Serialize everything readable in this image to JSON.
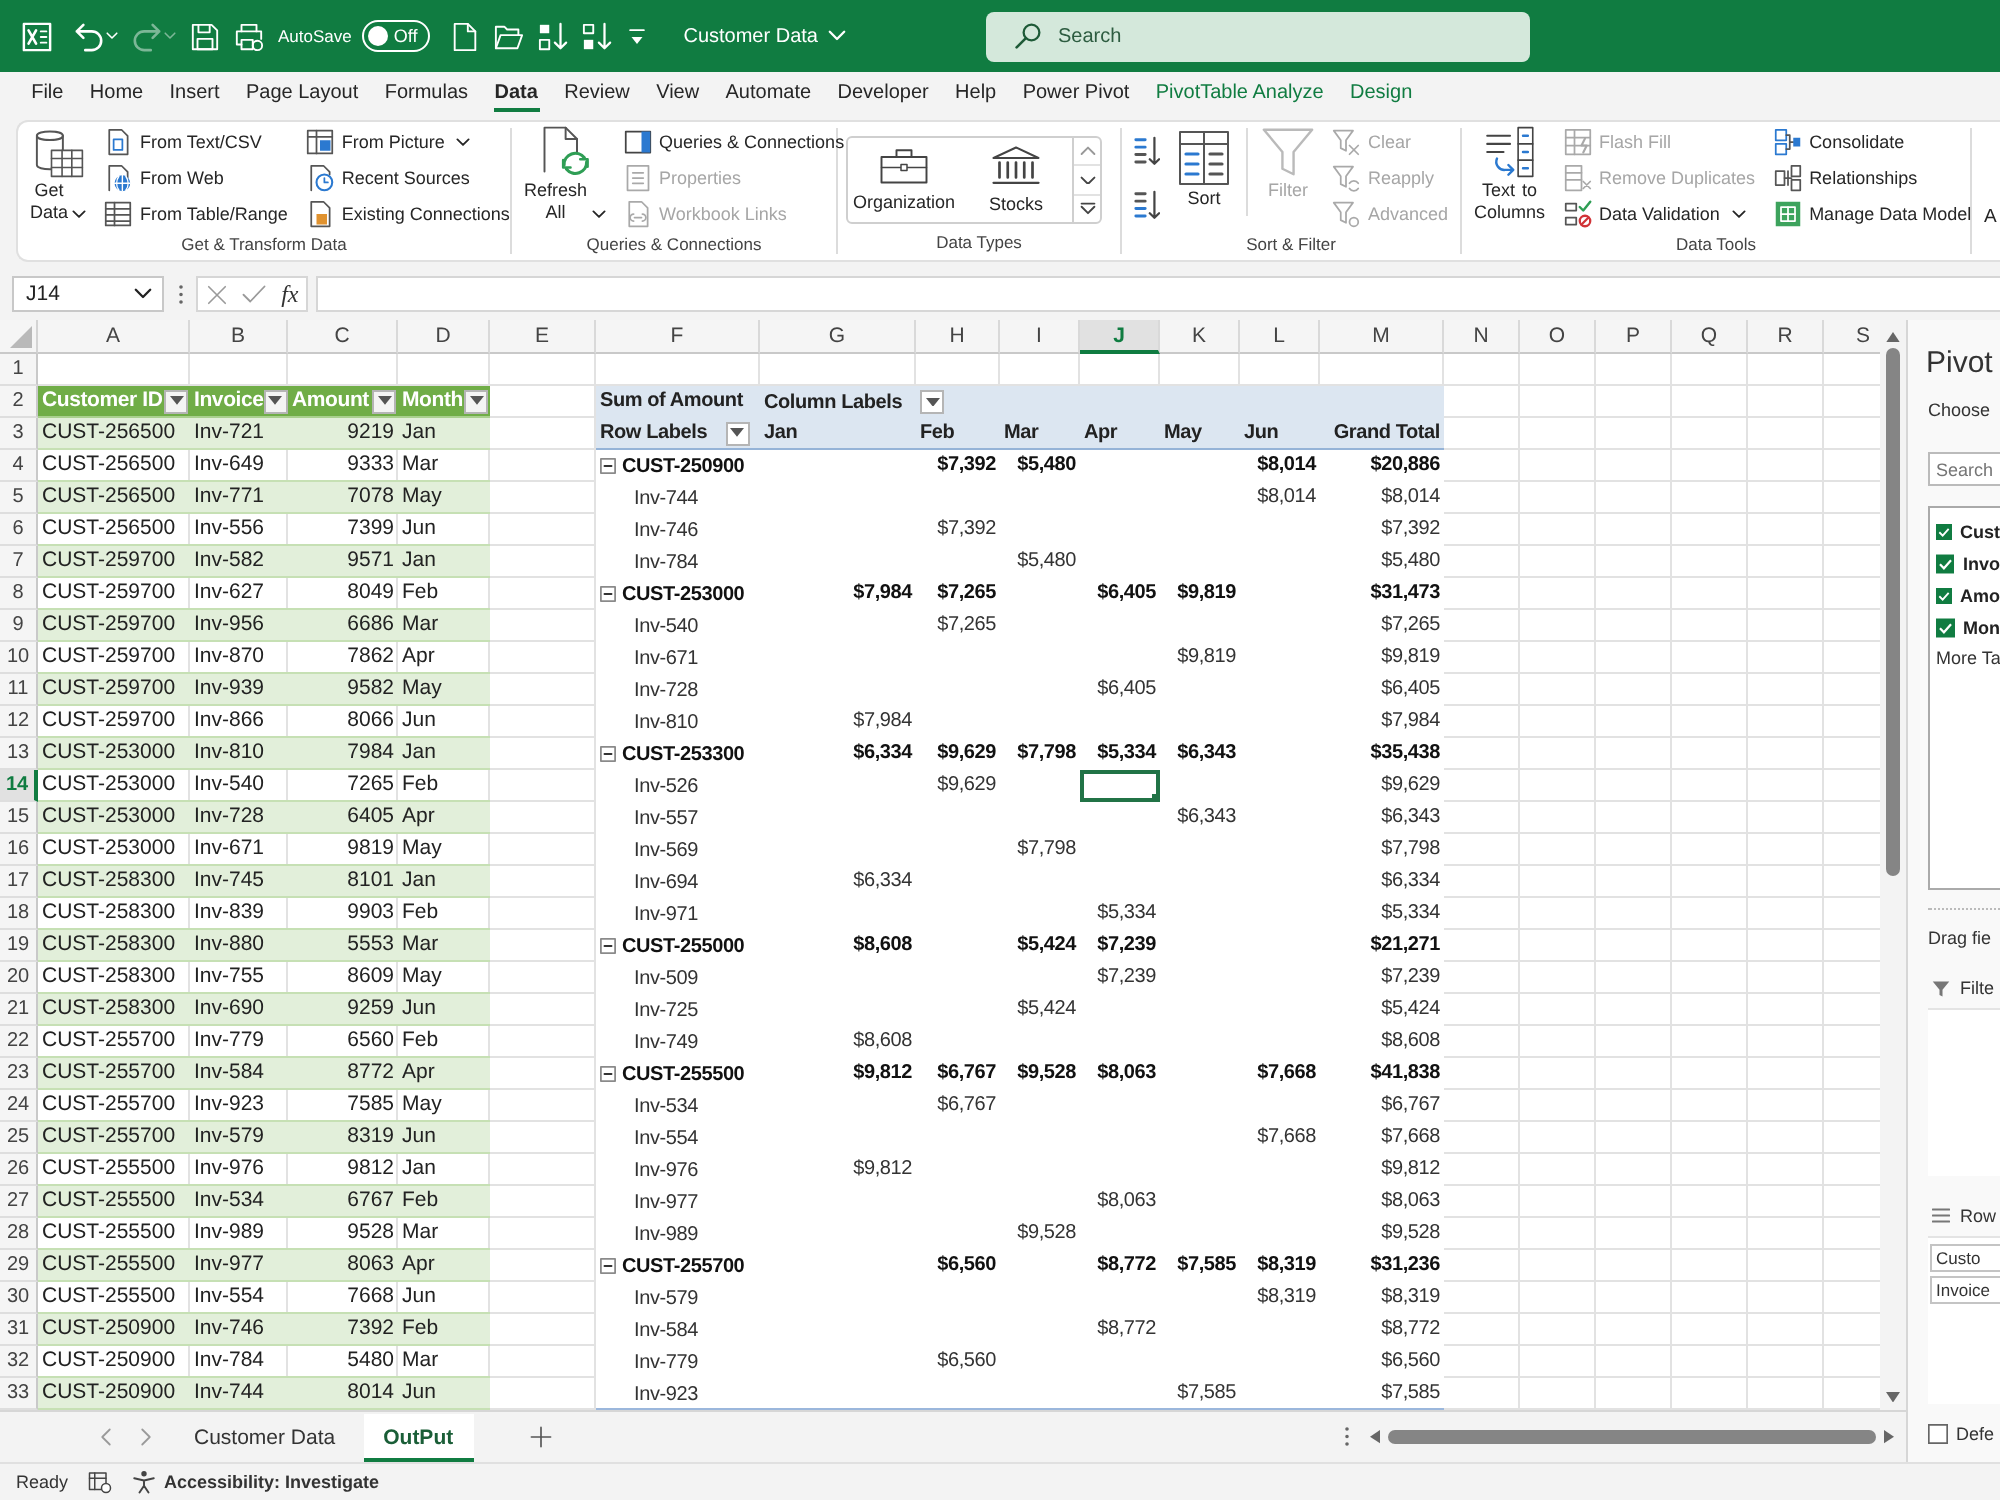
{
  "title_bar": {
    "quick_access": [
      {
        "kind": "undo",
        "disabled": false
      },
      {
        "kind": "redo",
        "disabled": true
      },
      {
        "kind": "save",
        "disabled": false
      },
      {
        "kind": "touch",
        "disabled": false
      },
      {
        "kind": "autosave",
        "label": "AutoSave",
        "on": false,
        "state_label": "Off",
        "disabled": false
      },
      {
        "kind": "new",
        "disabled": false
      },
      {
        "kind": "open",
        "disabled": false
      },
      {
        "kind": "sort_asc",
        "disabled": false
      },
      {
        "kind": "sort_desc",
        "disabled": false
      },
      {
        "kind": "customize",
        "disabled": false
      }
    ],
    "document_title": "Customer Data",
    "search": {
      "placeholder": "Search"
    }
  },
  "menu_tabs": [
    {
      "label": "File",
      "selected": false,
      "contextual": false
    },
    {
      "label": "Home",
      "selected": false,
      "contextual": false
    },
    {
      "label": "Insert",
      "selected": false,
      "contextual": false
    },
    {
      "label": "Page Layout",
      "selected": false,
      "contextual": false
    },
    {
      "label": "Formulas",
      "selected": false,
      "contextual": false
    },
    {
      "label": "Data",
      "selected": true,
      "contextual": false
    },
    {
      "label": "Review",
      "selected": false,
      "contextual": false
    },
    {
      "label": "View",
      "selected": false,
      "contextual": false
    },
    {
      "label": "Automate",
      "selected": false,
      "contextual": false
    },
    {
      "label": "Developer",
      "selected": false,
      "contextual": false
    },
    {
      "label": "Help",
      "selected": false,
      "contextual": false
    },
    {
      "label": "Power Pivot",
      "selected": false,
      "contextual": false
    },
    {
      "label": "PivotTable Analyze",
      "selected": false,
      "contextual": true
    },
    {
      "label": "Design",
      "selected": false,
      "contextual": true
    }
  ],
  "ribbon": {
    "groups": [
      {
        "label": "Get & Transform Data",
        "columns": [
          [
            {
              "kind": "large",
              "label": "Get Data",
              "dropdown": true,
              "disabled": false
            }
          ],
          [
            {
              "kind": "small",
              "label": "From Text/CSV",
              "dropdown": false,
              "disabled": false
            },
            {
              "kind": "small",
              "label": "From Web",
              "dropdown": false,
              "disabled": false
            },
            {
              "kind": "small",
              "label": "From Table/Range",
              "dropdown": false,
              "disabled": false
            }
          ],
          [
            {
              "kind": "small",
              "label": "From Picture",
              "dropdown": true,
              "disabled": false
            },
            {
              "kind": "small",
              "label": "Recent Sources",
              "dropdown": false,
              "disabled": false
            },
            {
              "kind": "small",
              "label": "Existing Connections",
              "dropdown": false,
              "disabled": false
            }
          ]
        ]
      },
      {
        "label": "Queries & Connections",
        "columns": [
          [
            {
              "kind": "large",
              "label": "Refresh All",
              "dropdown": true,
              "disabled": false
            }
          ],
          [
            {
              "kind": "small",
              "label": "Queries & Connections",
              "dropdown": false,
              "disabled": false
            },
            {
              "kind": "small",
              "label": "Properties",
              "dropdown": false,
              "disabled": true
            },
            {
              "kind": "small",
              "label": "Workbook Links",
              "dropdown": false,
              "disabled": true
            }
          ]
        ]
      },
      {
        "label": "Data Types",
        "columns": [
          [
            {
              "kind": "gallery",
              "disabled": false,
              "items": [
                {
                  "label": "Organization"
                },
                {
                  "label": "Stocks"
                }
              ]
            }
          ]
        ]
      },
      {
        "label": "Sort & Filter",
        "columns": [
          [
            {
              "kind": "icon",
              "dropdown": false,
              "disabled": false
            },
            {
              "kind": "icon",
              "dropdown": false,
              "disabled": false
            }
          ],
          [
            {
              "kind": "large",
              "label": "Sort",
              "dropdown": false,
              "disabled": false
            }
          ],
          [
            {
              "kind": "large",
              "label": "Filter",
              "dropdown": false,
              "disabled": true
            }
          ],
          [
            {
              "kind": "small",
              "label": "Clear",
              "dropdown": false,
              "disabled": true
            },
            {
              "kind": "small",
              "label": "Reapply",
              "dropdown": false,
              "disabled": true
            },
            {
              "kind": "small",
              "label": "Advanced",
              "dropdown": false,
              "disabled": true
            }
          ]
        ]
      },
      {
        "label": "Data Tools",
        "columns": [
          [
            {
              "kind": "large",
              "label": "Text to Columns",
              "dropdown": false,
              "disabled": false
            }
          ],
          [
            {
              "kind": "small",
              "label": "Flash Fill",
              "dropdown": false,
              "disabled": true
            },
            {
              "kind": "small",
              "label": "Remove Duplicates",
              "dropdown": false,
              "disabled": true
            },
            {
              "kind": "small",
              "label": "Data Validation",
              "dropdown": true,
              "disabled": false
            }
          ],
          [
            {
              "kind": "small",
              "label": "Consolidate",
              "dropdown": false,
              "disabled": false
            },
            {
              "kind": "small",
              "label": "Relationships",
              "dropdown": false,
              "disabled": false
            },
            {
              "kind": "small",
              "label": "Manage Data Model",
              "dropdown": false,
              "disabled": false
            }
          ]
        ]
      },
      {
        "columns": [
          [
            {
              "kind": "text",
              "label": "A",
              "dropdown": false,
              "disabled": false
            }
          ]
        ]
      }
    ]
  },
  "formula_bar": {
    "name_box": "J14",
    "function_label": "fx"
  },
  "sheet": {
    "column_headers": [
      {
        "label": "A",
        "selected": false
      },
      {
        "label": "B",
        "selected": false
      },
      {
        "label": "C",
        "selected": false
      },
      {
        "label": "D",
        "selected": false
      },
      {
        "label": "E",
        "selected": false
      },
      {
        "label": "F",
        "selected": false
      },
      {
        "label": "G",
        "selected": false
      },
      {
        "label": "H",
        "selected": false
      },
      {
        "label": "I",
        "selected": false
      },
      {
        "label": "J",
        "selected": true
      },
      {
        "label": "K",
        "selected": false
      },
      {
        "label": "L",
        "selected": false
      },
      {
        "label": "M",
        "selected": false
      },
      {
        "label": "N",
        "selected": false
      },
      {
        "label": "O",
        "selected": false
      },
      {
        "label": "P",
        "selected": false
      },
      {
        "label": "Q",
        "selected": false
      },
      {
        "label": "R",
        "selected": false
      },
      {
        "label": "S",
        "selected": false
      }
    ],
    "row_numbers": [
      {
        "label": "1",
        "selected": false
      },
      {
        "label": "2",
        "selected": false
      },
      {
        "label": "3",
        "selected": false
      },
      {
        "label": "4",
        "selected": false
      },
      {
        "label": "5",
        "selected": false
      },
      {
        "label": "6",
        "selected": false
      },
      {
        "label": "7",
        "selected": false
      },
      {
        "label": "8",
        "selected": false
      },
      {
        "label": "9",
        "selected": false
      },
      {
        "label": "10",
        "selected": false
      },
      {
        "label": "11",
        "selected": false
      },
      {
        "label": "12",
        "selected": false
      },
      {
        "label": "13",
        "selected": false
      },
      {
        "label": "14",
        "selected": true
      },
      {
        "label": "15",
        "selected": false
      },
      {
        "label": "16",
        "selected": false
      },
      {
        "label": "17",
        "selected": false
      },
      {
        "label": "18",
        "selected": false
      },
      {
        "label": "19",
        "selected": false
      },
      {
        "label": "20",
        "selected": false
      },
      {
        "label": "21",
        "selected": false
      },
      {
        "label": "22",
        "selected": false
      },
      {
        "label": "23",
        "selected": false
      },
      {
        "label": "24",
        "selected": false
      },
      {
        "label": "25",
        "selected": false
      },
      {
        "label": "26",
        "selected": false
      },
      {
        "label": "27",
        "selected": false
      },
      {
        "label": "28",
        "selected": false
      },
      {
        "label": "29",
        "selected": false
      },
      {
        "label": "30",
        "selected": false
      },
      {
        "label": "31",
        "selected": false
      },
      {
        "label": "32",
        "selected": false
      },
      {
        "label": "33",
        "selected": false
      }
    ],
    "table": {
      "columns": [
        {
          "label": "Customer ID",
          "kind": "text"
        },
        {
          "label": "Invoice",
          "kind": "text"
        },
        {
          "label": "Amount",
          "kind": "number"
        },
        {
          "label": "Month",
          "kind": "text"
        }
      ],
      "rows": [
        [
          "CUST-256500",
          "Inv-721",
          "9219",
          "Jan"
        ],
        [
          "CUST-256500",
          "Inv-649",
          "9333",
          "Mar"
        ],
        [
          "CUST-256500",
          "Inv-771",
          "7078",
          "May"
        ],
        [
          "CUST-256500",
          "Inv-556",
          "7399",
          "Jun"
        ],
        [
          "CUST-259700",
          "Inv-582",
          "9571",
          "Jan"
        ],
        [
          "CUST-259700",
          "Inv-627",
          "8049",
          "Feb"
        ],
        [
          "CUST-259700",
          "Inv-956",
          "6686",
          "Mar"
        ],
        [
          "CUST-259700",
          "Inv-870",
          "7862",
          "Apr"
        ],
        [
          "CUST-259700",
          "Inv-939",
          "9582",
          "May"
        ],
        [
          "CUST-259700",
          "Inv-866",
          "8066",
          "Jun"
        ],
        [
          "CUST-253000",
          "Inv-810",
          "7984",
          "Jan"
        ],
        [
          "CUST-253000",
          "Inv-540",
          "7265",
          "Feb"
        ],
        [
          "CUST-253000",
          "Inv-728",
          "6405",
          "Apr"
        ],
        [
          "CUST-253000",
          "Inv-671",
          "9819",
          "May"
        ],
        [
          "CUST-258300",
          "Inv-745",
          "8101",
          "Jan"
        ],
        [
          "CUST-258300",
          "Inv-839",
          "9903",
          "Feb"
        ],
        [
          "CUST-258300",
          "Inv-880",
          "5553",
          "Mar"
        ],
        [
          "CUST-258300",
          "Inv-755",
          "8609",
          "May"
        ],
        [
          "CUST-258300",
          "Inv-690",
          "9259",
          "Jun"
        ],
        [
          "CUST-255700",
          "Inv-779",
          "6560",
          "Feb"
        ],
        [
          "CUST-255700",
          "Inv-584",
          "8772",
          "Apr"
        ],
        [
          "CUST-255700",
          "Inv-923",
          "7585",
          "May"
        ],
        [
          "CUST-255700",
          "Inv-579",
          "8319",
          "Jun"
        ],
        [
          "CUST-255500",
          "Inv-976",
          "9812",
          "Jan"
        ],
        [
          "CUST-255500",
          "Inv-534",
          "6767",
          "Feb"
        ],
        [
          "CUST-255500",
          "Inv-989",
          "9528",
          "Mar"
        ],
        [
          "CUST-255500",
          "Inv-977",
          "8063",
          "Apr"
        ],
        [
          "CUST-255500",
          "Inv-554",
          "7668",
          "Jun"
        ],
        [
          "CUST-250900",
          "Inv-746",
          "7392",
          "Feb"
        ],
        [
          "CUST-250900",
          "Inv-784",
          "5480",
          "Mar"
        ],
        [
          "CUST-250900",
          "Inv-744",
          "8014",
          "Jun"
        ]
      ]
    },
    "pivot": {
      "value_field": "Sum of Amount",
      "column_field": "Column Labels",
      "row_field": "Row Labels",
      "columns": [
        "Jan",
        "Feb",
        "Mar",
        "Apr",
        "May",
        "Jun",
        "Grand Total"
      ],
      "rows": [
        {
          "label": "CUST-250900",
          "expanded": true,
          "cells": [
            null,
            "$7,392",
            "$5,480",
            null,
            null,
            "$8,014",
            "$20,886"
          ],
          "children": [
            {
              "label": "Inv-744",
              "cells": [
                null,
                null,
                null,
                null,
                null,
                "$8,014",
                "$8,014"
              ]
            },
            {
              "label": "Inv-746",
              "cells": [
                null,
                "$7,392",
                null,
                null,
                null,
                null,
                "$7,392"
              ]
            },
            {
              "label": "Inv-784",
              "cells": [
                null,
                null,
                "$5,480",
                null,
                null,
                null,
                "$5,480"
              ]
            }
          ]
        },
        {
          "label": "CUST-253000",
          "expanded": true,
          "cells": [
            "$7,984",
            "$7,265",
            null,
            "$6,405",
            "$9,819",
            null,
            "$31,473"
          ],
          "children": [
            {
              "label": "Inv-540",
              "cells": [
                null,
                "$7,265",
                null,
                null,
                null,
                null,
                "$7,265"
              ]
            },
            {
              "label": "Inv-671",
              "cells": [
                null,
                null,
                null,
                null,
                "$9,819",
                null,
                "$9,819"
              ]
            },
            {
              "label": "Inv-728",
              "cells": [
                null,
                null,
                null,
                "$6,405",
                null,
                null,
                "$6,405"
              ]
            },
            {
              "label": "Inv-810",
              "cells": [
                "$7,984",
                null,
                null,
                null,
                null,
                null,
                "$7,984"
              ]
            }
          ]
        },
        {
          "label": "CUST-253300",
          "expanded": true,
          "cells": [
            "$6,334",
            "$9,629",
            "$7,798",
            "$5,334",
            "$6,343",
            null,
            "$35,438"
          ],
          "children": [
            {
              "label": "Inv-526",
              "cells": [
                null,
                "$9,629",
                null,
                null,
                null,
                null,
                "$9,629"
              ]
            },
            {
              "label": "Inv-557",
              "cells": [
                null,
                null,
                null,
                null,
                "$6,343",
                null,
                "$6,343"
              ]
            },
            {
              "label": "Inv-569",
              "cells": [
                null,
                null,
                "$7,798",
                null,
                null,
                null,
                "$7,798"
              ]
            },
            {
              "label": "Inv-694",
              "cells": [
                "$6,334",
                null,
                null,
                null,
                null,
                null,
                "$6,334"
              ]
            },
            {
              "label": "Inv-971",
              "cells": [
                null,
                null,
                null,
                "$5,334",
                null,
                null,
                "$5,334"
              ]
            }
          ]
        },
        {
          "label": "CUST-255000",
          "expanded": true,
          "cells": [
            "$8,608",
            null,
            "$5,424",
            "$7,239",
            null,
            null,
            "$21,271"
          ],
          "children": [
            {
              "label": "Inv-509",
              "cells": [
                null,
                null,
                null,
                "$7,239",
                null,
                null,
                "$7,239"
              ]
            },
            {
              "label": "Inv-725",
              "cells": [
                null,
                null,
                "$5,424",
                null,
                null,
                null,
                "$5,424"
              ]
            },
            {
              "label": "Inv-749",
              "cells": [
                "$8,608",
                null,
                null,
                null,
                null,
                null,
                "$8,608"
              ]
            }
          ]
        },
        {
          "label": "CUST-255500",
          "expanded": true,
          "cells": [
            "$9,812",
            "$6,767",
            "$9,528",
            "$8,063",
            null,
            "$7,668",
            "$41,838"
          ],
          "children": [
            {
              "label": "Inv-534",
              "cells": [
                null,
                "$6,767",
                null,
                null,
                null,
                null,
                "$6,767"
              ]
            },
            {
              "label": "Inv-554",
              "cells": [
                null,
                null,
                null,
                null,
                null,
                "$7,668",
                "$7,668"
              ]
            },
            {
              "label": "Inv-976",
              "cells": [
                "$9,812",
                null,
                null,
                null,
                null,
                null,
                "$9,812"
              ]
            },
            {
              "label": "Inv-977",
              "cells": [
                null,
                null,
                null,
                "$8,063",
                null,
                null,
                "$8,063"
              ]
            },
            {
              "label": "Inv-989",
              "cells": [
                null,
                null,
                "$9,528",
                null,
                null,
                null,
                "$9,528"
              ]
            }
          ]
        },
        {
          "label": "CUST-255700",
          "expanded": true,
          "cells": [
            null,
            "$6,560",
            null,
            "$8,772",
            "$7,585",
            "$8,319",
            "$31,236"
          ],
          "children": [
            {
              "label": "Inv-579",
              "cells": [
                null,
                null,
                null,
                null,
                null,
                "$8,319",
                "$8,319"
              ]
            },
            {
              "label": "Inv-584",
              "cells": [
                null,
                null,
                null,
                "$8,772",
                null,
                null,
                "$8,772"
              ]
            },
            {
              "label": "Inv-779",
              "cells": [
                null,
                "$6,560",
                null,
                null,
                null,
                null,
                "$6,560"
              ]
            },
            {
              "label": "Inv-923",
              "cells": [
                null,
                null,
                null,
                null,
                "$7,585",
                null,
                "$7,585"
              ]
            }
          ]
        }
      ]
    }
  },
  "sheet_tabs": [
    {
      "label": "Customer Data",
      "selected": false
    },
    {
      "label": "OutPut",
      "selected": true
    }
  ],
  "field_pane": {
    "title": "Pivot",
    "subtitle": "Choose",
    "search": {
      "placeholder": "Search"
    },
    "fields": [
      {
        "label": "Cust",
        "checked": true
      },
      {
        "label": "Invo",
        "checked": true
      },
      {
        "label": "Amo",
        "checked": true
      },
      {
        "label": "Mon",
        "checked": true
      }
    ],
    "more_tables": "More Ta",
    "drag_hint": "Drag fie",
    "areas": [
      {
        "kind": "filters",
        "label": "Filte"
      },
      {
        "kind": "rows",
        "label": "Row",
        "items": [
          "Custo",
          "Invoice"
        ]
      }
    ],
    "defer": {
      "label": "Defe",
      "checked": false
    }
  },
  "status_bar": {
    "mode": "Ready",
    "accessibility": "Accessibility: Investigate"
  }
}
